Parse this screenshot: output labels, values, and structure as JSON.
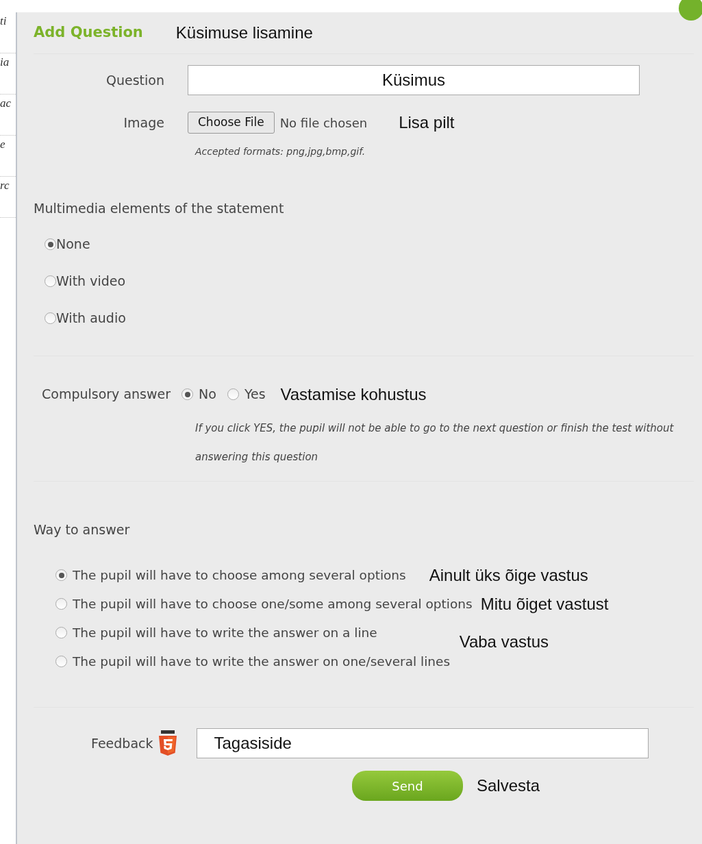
{
  "background_fragments": [
    "ti",
    "ia",
    "ac",
    "e",
    "rc"
  ],
  "dialog": {
    "title": "Add Question",
    "title_annotation": "Küsimuse lisamine",
    "question": {
      "label": "Question",
      "value": "Küsimus"
    },
    "image": {
      "label": "Image",
      "button": "Choose File",
      "status": "No file chosen",
      "annotation": "Lisa pilt",
      "hint": "Accepted formats: png,jpg,bmp,gif."
    },
    "multimedia": {
      "label": "Multimedia elements of the statement",
      "options": [
        {
          "label": "None",
          "selected": true
        },
        {
          "label": "With video",
          "selected": false
        },
        {
          "label": "With audio",
          "selected": false
        }
      ]
    },
    "compulsory": {
      "label": "Compulsory answer",
      "options": [
        {
          "label": "No",
          "selected": true
        },
        {
          "label": "Yes",
          "selected": false
        }
      ],
      "annotation": "Vastamise kohustus",
      "hint": "If you click YES, the pupil will not be able to go to the next question or finish the test without answering this question"
    },
    "way": {
      "label": "Way to answer",
      "options": [
        {
          "label": "The pupil will have to choose among several options",
          "selected": true,
          "annotation": "Ainult üks õige vastus"
        },
        {
          "label": "The pupil will have to choose one/some among several options",
          "selected": false,
          "annotation": "Mitu õiget vastust"
        },
        {
          "label": "The pupil will have to write the answer on a line",
          "selected": false,
          "annotation": "Vaba vastus"
        },
        {
          "label": "The pupil will have to write the answer on one/several lines",
          "selected": false
        }
      ]
    },
    "feedback": {
      "label": "Feedback",
      "value": "Tagasiside"
    },
    "send": {
      "label": "Send",
      "annotation": "Salvesta"
    }
  }
}
